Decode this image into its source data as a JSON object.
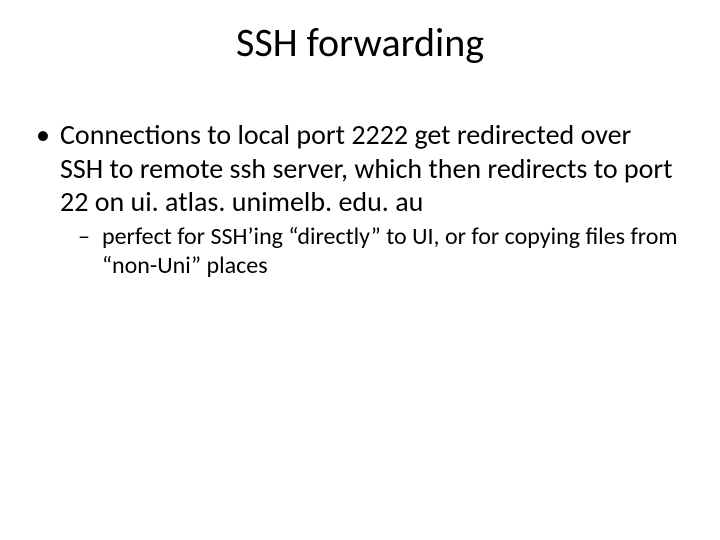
{
  "slide": {
    "title": "SSH forwarding",
    "bullets": [
      {
        "text": "Connections to local port 2222 get redirected over SSH to remote ssh server, which then redirects to port 22 on ui. atlas. unimelb. edu. au",
        "sub": [
          {
            "text": "perfect for SSH’ing “directly” to UI, or for copying files from “non-Uni” places"
          }
        ]
      }
    ]
  }
}
